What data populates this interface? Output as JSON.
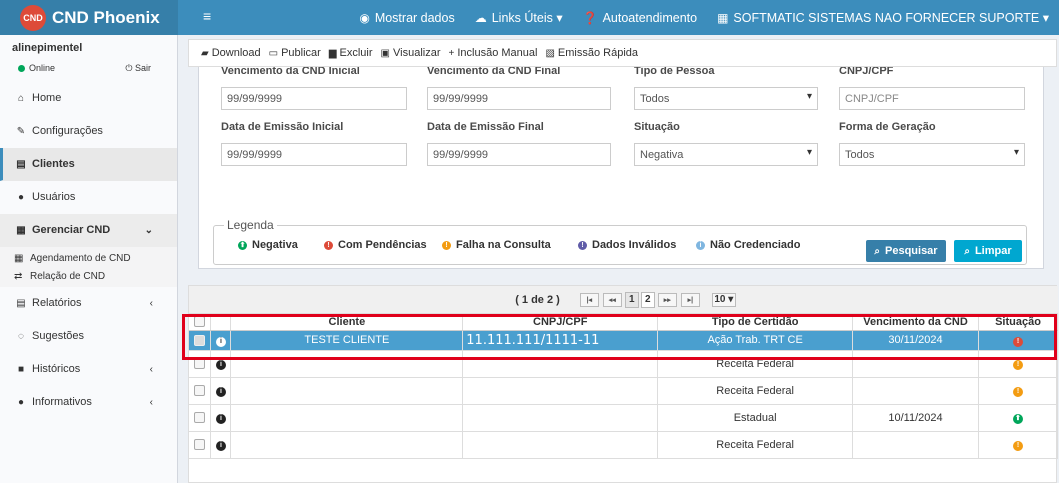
{
  "brand": {
    "logo_text": "CND Phoenix",
    "logo_badge": "CND"
  },
  "topnav": {
    "items": [
      {
        "icon": "eye-icon",
        "glyph": "◉",
        "label": "Mostrar dados"
      },
      {
        "icon": "cloud-icon",
        "glyph": "☁",
        "label": "Links Úteis ▾"
      },
      {
        "icon": "question-icon",
        "glyph": "❓",
        "label": "Autoatendimento"
      },
      {
        "icon": "building-icon",
        "glyph": "▦",
        "label": "SOFTMATIC SISTEMAS NAO FORNECER SUPORTE ▾"
      }
    ]
  },
  "user": {
    "name": "alinepimentel",
    "status": "Online",
    "logout": "Sair"
  },
  "sidebar": {
    "items": [
      {
        "label": "Home",
        "glyph": "⌂",
        "icon": "home-icon"
      },
      {
        "label": "Configurações",
        "glyph": "✎",
        "icon": "wrench-icon"
      },
      {
        "label": "Clientes",
        "glyph": "▤",
        "icon": "building-icon"
      },
      {
        "label": "Usuários",
        "glyph": "●",
        "icon": "user-icon"
      },
      {
        "label": "Gerenciar CND",
        "glyph": "▦",
        "icon": "calendar-icon",
        "chev": "⌄"
      },
      {
        "label": "Relatórios",
        "glyph": "▤",
        "icon": "report-icon",
        "chev": "‹"
      },
      {
        "label": "Sugestões",
        "glyph": "◌",
        "icon": "comment-icon"
      },
      {
        "label": "Históricos",
        "glyph": "■",
        "icon": "history-icon",
        "chev": "‹"
      },
      {
        "label": "Informativos",
        "glyph": "●",
        "icon": "info-icon",
        "chev": "‹"
      }
    ],
    "sub": [
      {
        "label": "Agendamento de CND",
        "glyph": "▦",
        "icon": "calendar-icon"
      },
      {
        "label": "Relação de CND",
        "glyph": "⇄",
        "icon": "exchange-icon"
      }
    ]
  },
  "toolbar": {
    "items": [
      {
        "label": "Download",
        "glyph": "▰",
        "icon": "download-icon"
      },
      {
        "label": "Publicar",
        "glyph": "▭",
        "icon": "publish-icon"
      },
      {
        "label": "Excluir",
        "glyph": "▆",
        "icon": "trash-icon"
      },
      {
        "label": "Visualizar",
        "glyph": "▣",
        "icon": "view-icon"
      },
      {
        "label": "Inclusão Manual",
        "glyph": "+",
        "icon": "plus-icon"
      },
      {
        "label": "Emissão Rápida",
        "glyph": "▧",
        "icon": "fast-icon"
      }
    ]
  },
  "filters": {
    "venc_ini_label": "Vencimento da CND Inicial",
    "venc_ini_value": "99/99/9999",
    "venc_fim_label": "Vencimento da CND Final",
    "venc_fim_value": "99/99/9999",
    "tipo_pessoa_label": "Tipo de Pessoa",
    "tipo_pessoa_value": "Todos",
    "cnpj_label": "CNPJ/CPF",
    "cnpj_placeholder": "CNPJ/CPF",
    "emis_ini_label": "Data de Emissão Inicial",
    "emis_ini_value": "99/99/9999",
    "emis_fim_label": "Data de Emissão Final",
    "emis_fim_value": "99/99/9999",
    "situacao_label": "Situação",
    "situacao_value": "Negativa",
    "forma_label": "Forma de Geração",
    "forma_value": "Todos"
  },
  "legend": {
    "title": "Legenda",
    "items": [
      {
        "label": "Negativa",
        "color": "#00a65a",
        "glyph": "⬆"
      },
      {
        "label": "Com Pendências",
        "color": "#dd4b39",
        "glyph": "!"
      },
      {
        "label": "Falha na Consulta",
        "color": "#f39c12",
        "glyph": "!"
      },
      {
        "label": "Dados Inválidos",
        "color": "#605ca8",
        "glyph": "!"
      },
      {
        "label": "Não Credenciado",
        "color": "#7fb6e0",
        "glyph": "i"
      }
    ]
  },
  "buttons": {
    "search": "Pesquisar",
    "clear": "Limpar",
    "search_color": "#367fa9",
    "clear_color": "#00a7d0"
  },
  "pager": {
    "summary": "( 1 de 2 )",
    "first": "|◂",
    "prev": "◂◂",
    "pages": [
      "1",
      "2"
    ],
    "next": "▸▸",
    "last": "▸|",
    "page_size": "10 ▾"
  },
  "table": {
    "headers": [
      "Cliente",
      "CNPJ/CPF",
      "Tipo de Certidão",
      "Vencimento da CND",
      "Situação"
    ],
    "rows": [
      {
        "cliente": "TESTE CLIENTE",
        "cnpj": "11.111.111/1111-11",
        "tipo": "Ação Trab. TRT CE",
        "venc": "30/11/2024",
        "status_color": "#dd4b39",
        "status_glyph": "!",
        "highlight": true
      },
      {
        "cliente": "",
        "cnpj": "",
        "tipo": "Receita Federal",
        "venc": "",
        "status_color": "#f39c12",
        "status_glyph": "!"
      },
      {
        "cliente": "",
        "cnpj": "",
        "tipo": "Receita Federal",
        "venc": "",
        "status_color": "#f39c12",
        "status_glyph": "!"
      },
      {
        "cliente": "",
        "cnpj": "",
        "tipo": "Estadual",
        "venc": "10/11/2024",
        "status_color": "#00a65a",
        "status_glyph": "⬆"
      },
      {
        "cliente": "",
        "cnpj": "",
        "tipo": "Receita Federal",
        "venc": "",
        "status_color": "#f39c12",
        "status_glyph": "!"
      }
    ]
  }
}
